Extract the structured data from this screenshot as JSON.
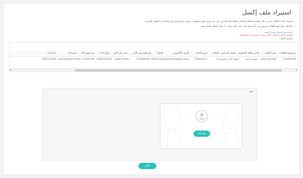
{
  "page": {
    "title": "استيراد ملف إكسل",
    "desc_1": "استيراد بيانات الطلاب يتم من خلال تعبئة هذا الملف بالبيانات التالية علماً بأنه في حال عدم وجود بعض المعلومات يمكن تركها فارغة مع مراعاة ملء الحقول الإجبارية",
    "desc_2": "ملاحظة: حقل هوية الطالب ضروري في حال تعبئة بيانات ولي الأمر ويجب أن يكون الحقل بصيغة نصية",
    "desc_3": "اضغط هنا لتحميل نموذج الملف",
    "desc_4": "الحقول الإجبارية باللون الأحمر ويجب تعبئتها قبل رفع الملف",
    "sample_heading": "نموذج الملف :"
  },
  "table": {
    "headers": [
      "رقم هوية الطالب",
      "اسم الطالب",
      "الاسم باللغة الإنجليزية",
      "الصف الدراسي",
      "الفصل",
      "تاريخ الميلاد",
      "البريد الإلكتروني",
      "الجوال",
      "رقم هوية ولي الأمر",
      "اسم ولي الأمر",
      "جوال الأب",
      "رقم هوية الأم",
      "اسم الأم",
      "جوال الأم"
    ],
    "row": [
      "123456789",
      "adam ahmad",
      "يوسف أحمد",
      "الصف الأول المتوسط",
      "1",
      "1990/01/01",
      "abc@company.com",
      "0555123456",
      "123456789",
      "adam smith",
      "0555123456",
      "123456789",
      "mohammed smith",
      "0555123456"
    ]
  },
  "upload": {
    "label": "ملف",
    "button": "رفع ملف"
  },
  "actions": {
    "save": "التالي"
  },
  "colors": {
    "accent": "#27c2b8",
    "link": "#2b8fd6",
    "required": "#e0544f"
  }
}
